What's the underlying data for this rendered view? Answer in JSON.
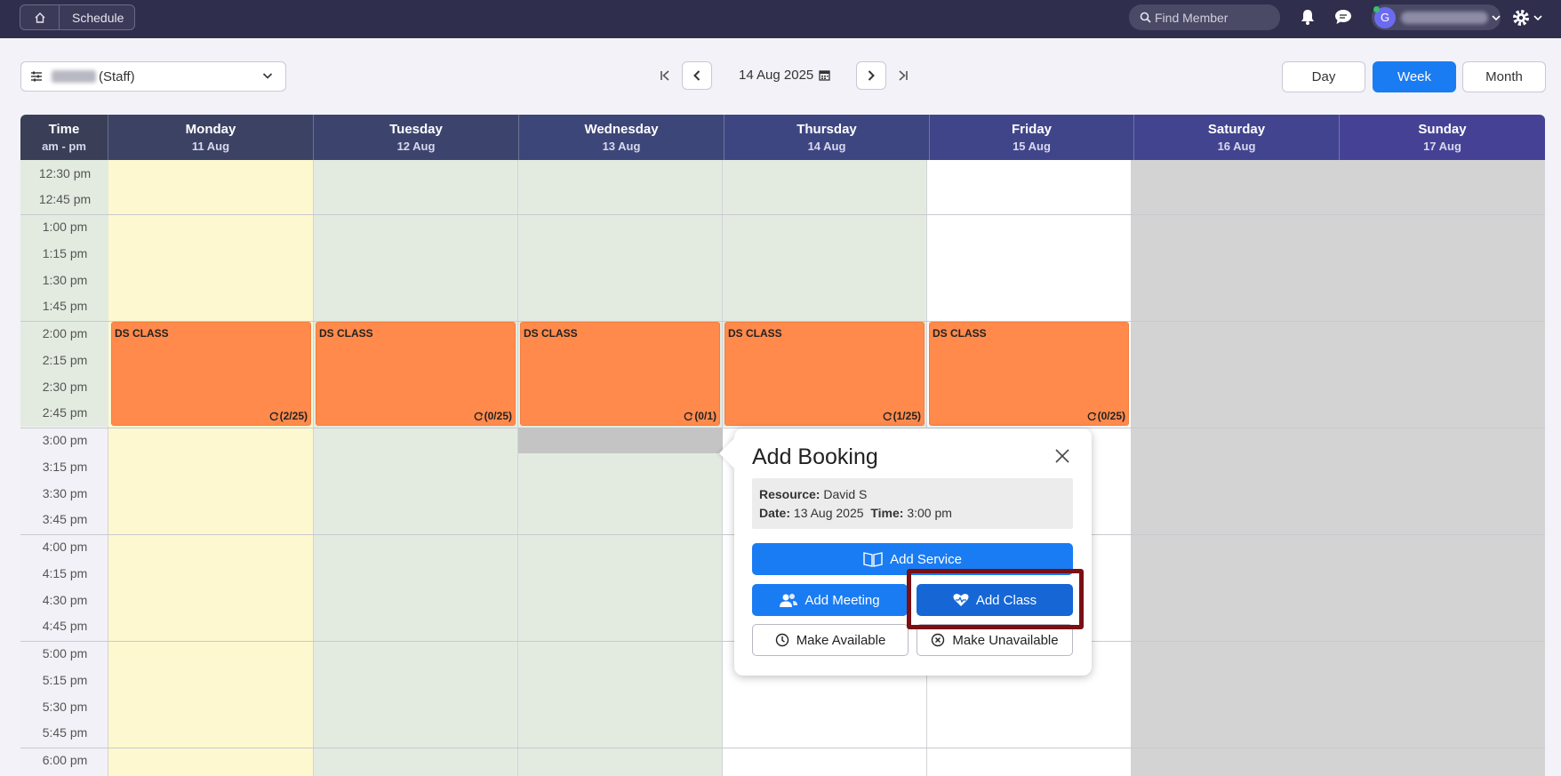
{
  "nav": {
    "breadcrumb_label": "Schedule",
    "search_placeholder": "Find Member",
    "avatar_initial": "G"
  },
  "toolbar": {
    "staff_suffix": "(Staff)",
    "current_date": "14 Aug 2025",
    "views": [
      "Day",
      "Week",
      "Month"
    ],
    "active_view": "Week"
  },
  "calendar": {
    "time_header": {
      "label": "Time",
      "sub": "am - pm"
    },
    "days": [
      {
        "name": "Monday",
        "date": "11 Aug"
      },
      {
        "name": "Tuesday",
        "date": "12 Aug"
      },
      {
        "name": "Wednesday",
        "date": "13 Aug"
      },
      {
        "name": "Thursday",
        "date": "14 Aug"
      },
      {
        "name": "Friday",
        "date": "15 Aug"
      },
      {
        "name": "Saturday",
        "date": "16 Aug"
      },
      {
        "name": "Sunday",
        "date": "17 Aug"
      }
    ],
    "times": [
      "12:30 pm",
      "12:45 pm",
      "1:00 pm",
      "1:15 pm",
      "1:30 pm",
      "1:45 pm",
      "2:00 pm",
      "2:15 pm",
      "2:30 pm",
      "2:45 pm",
      "3:00 pm",
      "3:15 pm",
      "3:30 pm",
      "3:45 pm",
      "4:00 pm",
      "4:15 pm",
      "4:30 pm",
      "4:45 pm",
      "5:00 pm",
      "5:15 pm",
      "5:30 pm",
      "5:45 pm",
      "6:00 pm"
    ],
    "events": [
      {
        "title": "DS CLASS",
        "count": "(2/25)"
      },
      {
        "title": "DS CLASS",
        "count": "(0/25)"
      },
      {
        "title": "DS CLASS",
        "count": "(0/1)"
      },
      {
        "title": "DS CLASS",
        "count": "(1/25)"
      },
      {
        "title": "DS CLASS",
        "count": "(0/25)"
      }
    ]
  },
  "popover": {
    "title": "Add Booking",
    "resource_label": "Resource:",
    "resource_value": "David S",
    "date_label": "Date:",
    "date_value": "13 Aug 2025",
    "time_label": "Time:",
    "time_value": "3:00 pm",
    "add_service": "Add Service",
    "add_meeting": "Add Meeting",
    "add_class": "Add Class",
    "make_available": "Make Available",
    "make_unavailable": "Make Unavailable"
  },
  "colors": {
    "topbar": "#2f2e4c",
    "accent": "#1a7cf3",
    "event": "#ff8a4c",
    "monday_bg": "#fdf8cf",
    "workday_bg": "#e3ebe1",
    "weekend_bg": "#d3d3d3",
    "highlight": "#7a0f14"
  }
}
